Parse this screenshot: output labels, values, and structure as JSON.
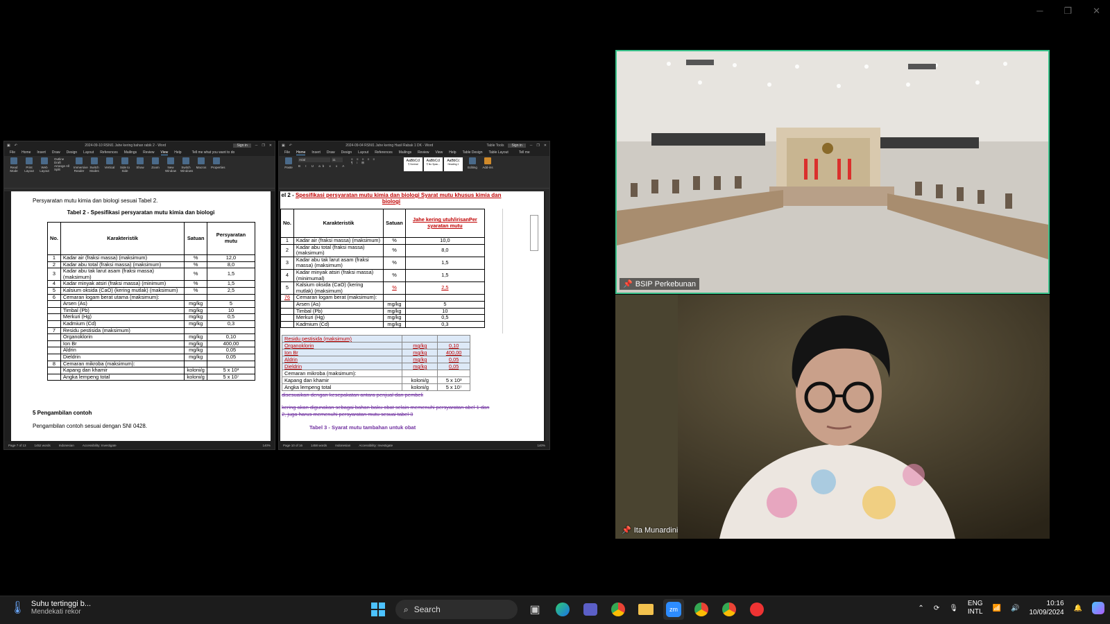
{
  "doc1": {
    "title": "2024-09-10 RSNI1 Jahe kering bahan rabik 2 - Word",
    "signin": "Sign in",
    "menu": [
      "File",
      "Home",
      "Insert",
      "Draw",
      "Design",
      "Layout",
      "References",
      "Mailings",
      "Review",
      "View",
      "Help"
    ],
    "active_menu": "View",
    "tellme": "Tell me what you want to do",
    "ribbon": [
      "Read Mode",
      "Print Layout",
      "Web Layout",
      "Immersive Reader",
      "Switch Modes",
      "Vertical",
      "Side to Side",
      "Show",
      "Zoom",
      "New Window",
      "Switch Windows",
      "Macros",
      "Properties"
    ],
    "ribbon_small": [
      "Outline",
      "Draft",
      "Arrange All",
      "Split"
    ],
    "groups": [
      "Views",
      "Immersive",
      "Dark Mode",
      "Page Movement",
      "Window",
      "Macros",
      "SharePoint"
    ],
    "intro": "Persyaratan mutu kimia dan biologi sesuai Tabel 2.",
    "table_title": "Tabel 2 - Spesifikasi persyaratan mutu kimia dan biologi",
    "headers": [
      "No.",
      "Karakteristik",
      "Satuan",
      "Persyaratan mutu"
    ],
    "rows": [
      [
        "1",
        "Kadar air (fraksi massa) (maksimum)",
        "%",
        "12,0"
      ],
      [
        "2",
        "Kadar abu total (fraksi massa) (maksimum)",
        "%",
        "8,0"
      ],
      [
        "3",
        "Kadar abu tak larut asam (fraksi massa) (maksimum)",
        "%",
        "1,5"
      ],
      [
        "4",
        "Kadar minyak atsiri (fraksi massa) (minimum)",
        "%",
        "1,5"
      ],
      [
        "5",
        "Kalsium oksida (CaO) (kering mutlak) (maksimum)",
        "%",
        "2,5"
      ],
      [
        "6",
        "Cemaran logam berat utama (maksimum):",
        "",
        ""
      ],
      [
        "",
        "Arsen (As)",
        "mg/kg",
        "5"
      ],
      [
        "",
        "Timbal (Pb)",
        "mg/kg",
        "10"
      ],
      [
        "",
        "Merkuri (Hg)",
        "mg/kg",
        "0,5"
      ],
      [
        "",
        "Kadmium (Cd)",
        "mg/kg",
        "0,3"
      ],
      [
        "7",
        "Residu pestisida (maksimum)",
        "",
        ""
      ],
      [
        "",
        "Organoklorin",
        "mg/kg",
        "0,10"
      ],
      [
        "",
        "Ion Br",
        "mg/kg",
        "400,00"
      ],
      [
        "",
        "Aldrin",
        "mg/kg",
        "0,05"
      ],
      [
        "",
        "Dieldrin",
        "mg/kg",
        "0,05"
      ],
      [
        "8",
        "Cemaran mikroba (maksimum):",
        "",
        ""
      ],
      [
        "",
        "Kapang dan khamir",
        "koloni/g",
        "5 x 10³"
      ],
      [
        "",
        "Angka lempeng total",
        "koloni/g",
        "5 x 10⁷"
      ]
    ],
    "section": "5    Pengambilan contoh",
    "section_text": "Pengambilan contoh sesuai dengan SNI 0428.",
    "status": [
      "Page 7 of 13",
      "1452 words",
      "Indonesian",
      "Accessibility: Investigate"
    ],
    "zoom": "140%"
  },
  "doc2": {
    "title": "2024-09-04 RSNI1 Jahe kering Hasil Rabak 1 DK - Word",
    "table_tools": "Table Tools",
    "signin": "Sign in",
    "menu": [
      "File",
      "Home",
      "Insert",
      "Draw",
      "Design",
      "Layout",
      "References",
      "Mailings",
      "Review",
      "View",
      "Help",
      "Table Design",
      "Table Layout"
    ],
    "active_menu": "Home",
    "tellme": "Tell me",
    "font": "Arial",
    "font_size": "11",
    "styles": [
      "AaBbCcI",
      "AaBbCcI",
      "AaBbCc"
    ],
    "style_names": [
      "¶ Normal",
      "¶ No Spac...",
      "Heading 1"
    ],
    "ribbon_right": [
      "Editing",
      "Add-ins"
    ],
    "groups": [
      "Clipboard",
      "Font",
      "Paragraph",
      "Styles",
      "Add-ins"
    ],
    "heading_prefix": "el 2 - ",
    "heading": "Spesifikasi persyaratan mutu kimia dan biologi Syarat mutu khusus kimia dan biologi",
    "headers": [
      "No.",
      "Karakteristik",
      "Satuan",
      "Jahe kering utuh/irisanPer syaratan mutu"
    ],
    "rows": [
      [
        "1",
        "Kadar air (fraksi massa) (maksimum)",
        "%",
        "10,0"
      ],
      [
        "2",
        "Kadar abu total (fraksi massa) (maksimum)",
        "%",
        "8,0"
      ],
      [
        "3",
        "Kadar abu tak larut asam (fraksi massa) (maksimum)",
        "%",
        "1,5"
      ],
      [
        "4",
        "Kadar minyak atsiri (fraksi massa) (minimumal)",
        "%",
        "1,5"
      ],
      [
        "5",
        "Kalsium oksida (CaO) (kering mutlak) (maksimum)",
        "%",
        "2,5"
      ],
      [
        "76",
        "Cemaran logam berat (maksimum):",
        "",
        ""
      ],
      [
        "",
        "Arsen (As)",
        "mg/kg",
        "5"
      ],
      [
        "",
        "Timbal (Pb)",
        "mg/kg",
        "10"
      ],
      [
        "",
        "Merkuri (Hg)",
        "mg/kg",
        "0,5"
      ],
      [
        "",
        "Kadmium (Cd)",
        "mg/kg",
        "0,3"
      ]
    ],
    "rows2": [
      [
        "Residu pestisida (maksimum)",
        "",
        ""
      ],
      [
        "Organoklorin",
        "mg/kg",
        "0,10"
      ],
      [
        "Ion Br",
        "mg/kg",
        "400,00"
      ],
      [
        "Aldrin",
        "mg/kg",
        "0,05"
      ],
      [
        "Dieldrin",
        "mg/kg",
        "0,05"
      ],
      [
        "Cemaran mikroba (maksimum):",
        "",
        ""
      ],
      [
        "Kapang dan khamir",
        "koloni/g",
        "5 x 10³"
      ],
      [
        "Angka lempeng total",
        "koloni/g",
        "5 x 10⁷"
      ]
    ],
    "deleted1": "disesuaikan dengan kesepakatan antara penjual dan pembeli",
    "deleted2": "kering akan digunakan sebagai bahan baku obat selain memenuhi persyaratan abel 1 dan 2, juga harus memenuhi persyaratan mutu sesuai tabel 3",
    "next_table": "Tabel 3 - Syarat mutu tambahan untuk obat",
    "status": [
      "Page 10 of 16",
      "1458 words",
      "Indonesian",
      "Accessibility: Investigate"
    ],
    "zoom": "140%"
  },
  "participants": [
    {
      "name": "BSIP Perkebunan",
      "active_speaker": true
    },
    {
      "name": "Ita Munardini",
      "active_speaker": false
    }
  ],
  "taskbar": {
    "weather_title": "Suhu tertinggi b...",
    "weather_sub": "Mendekati rekor",
    "search_label": "Search",
    "lang1": "ENG",
    "lang2": "INTL",
    "time": "10:16",
    "date": "10/09/2024"
  },
  "colors": {
    "active_border": "#39c28a",
    "track_change": "#c00000",
    "deleted": "#7030a0"
  }
}
